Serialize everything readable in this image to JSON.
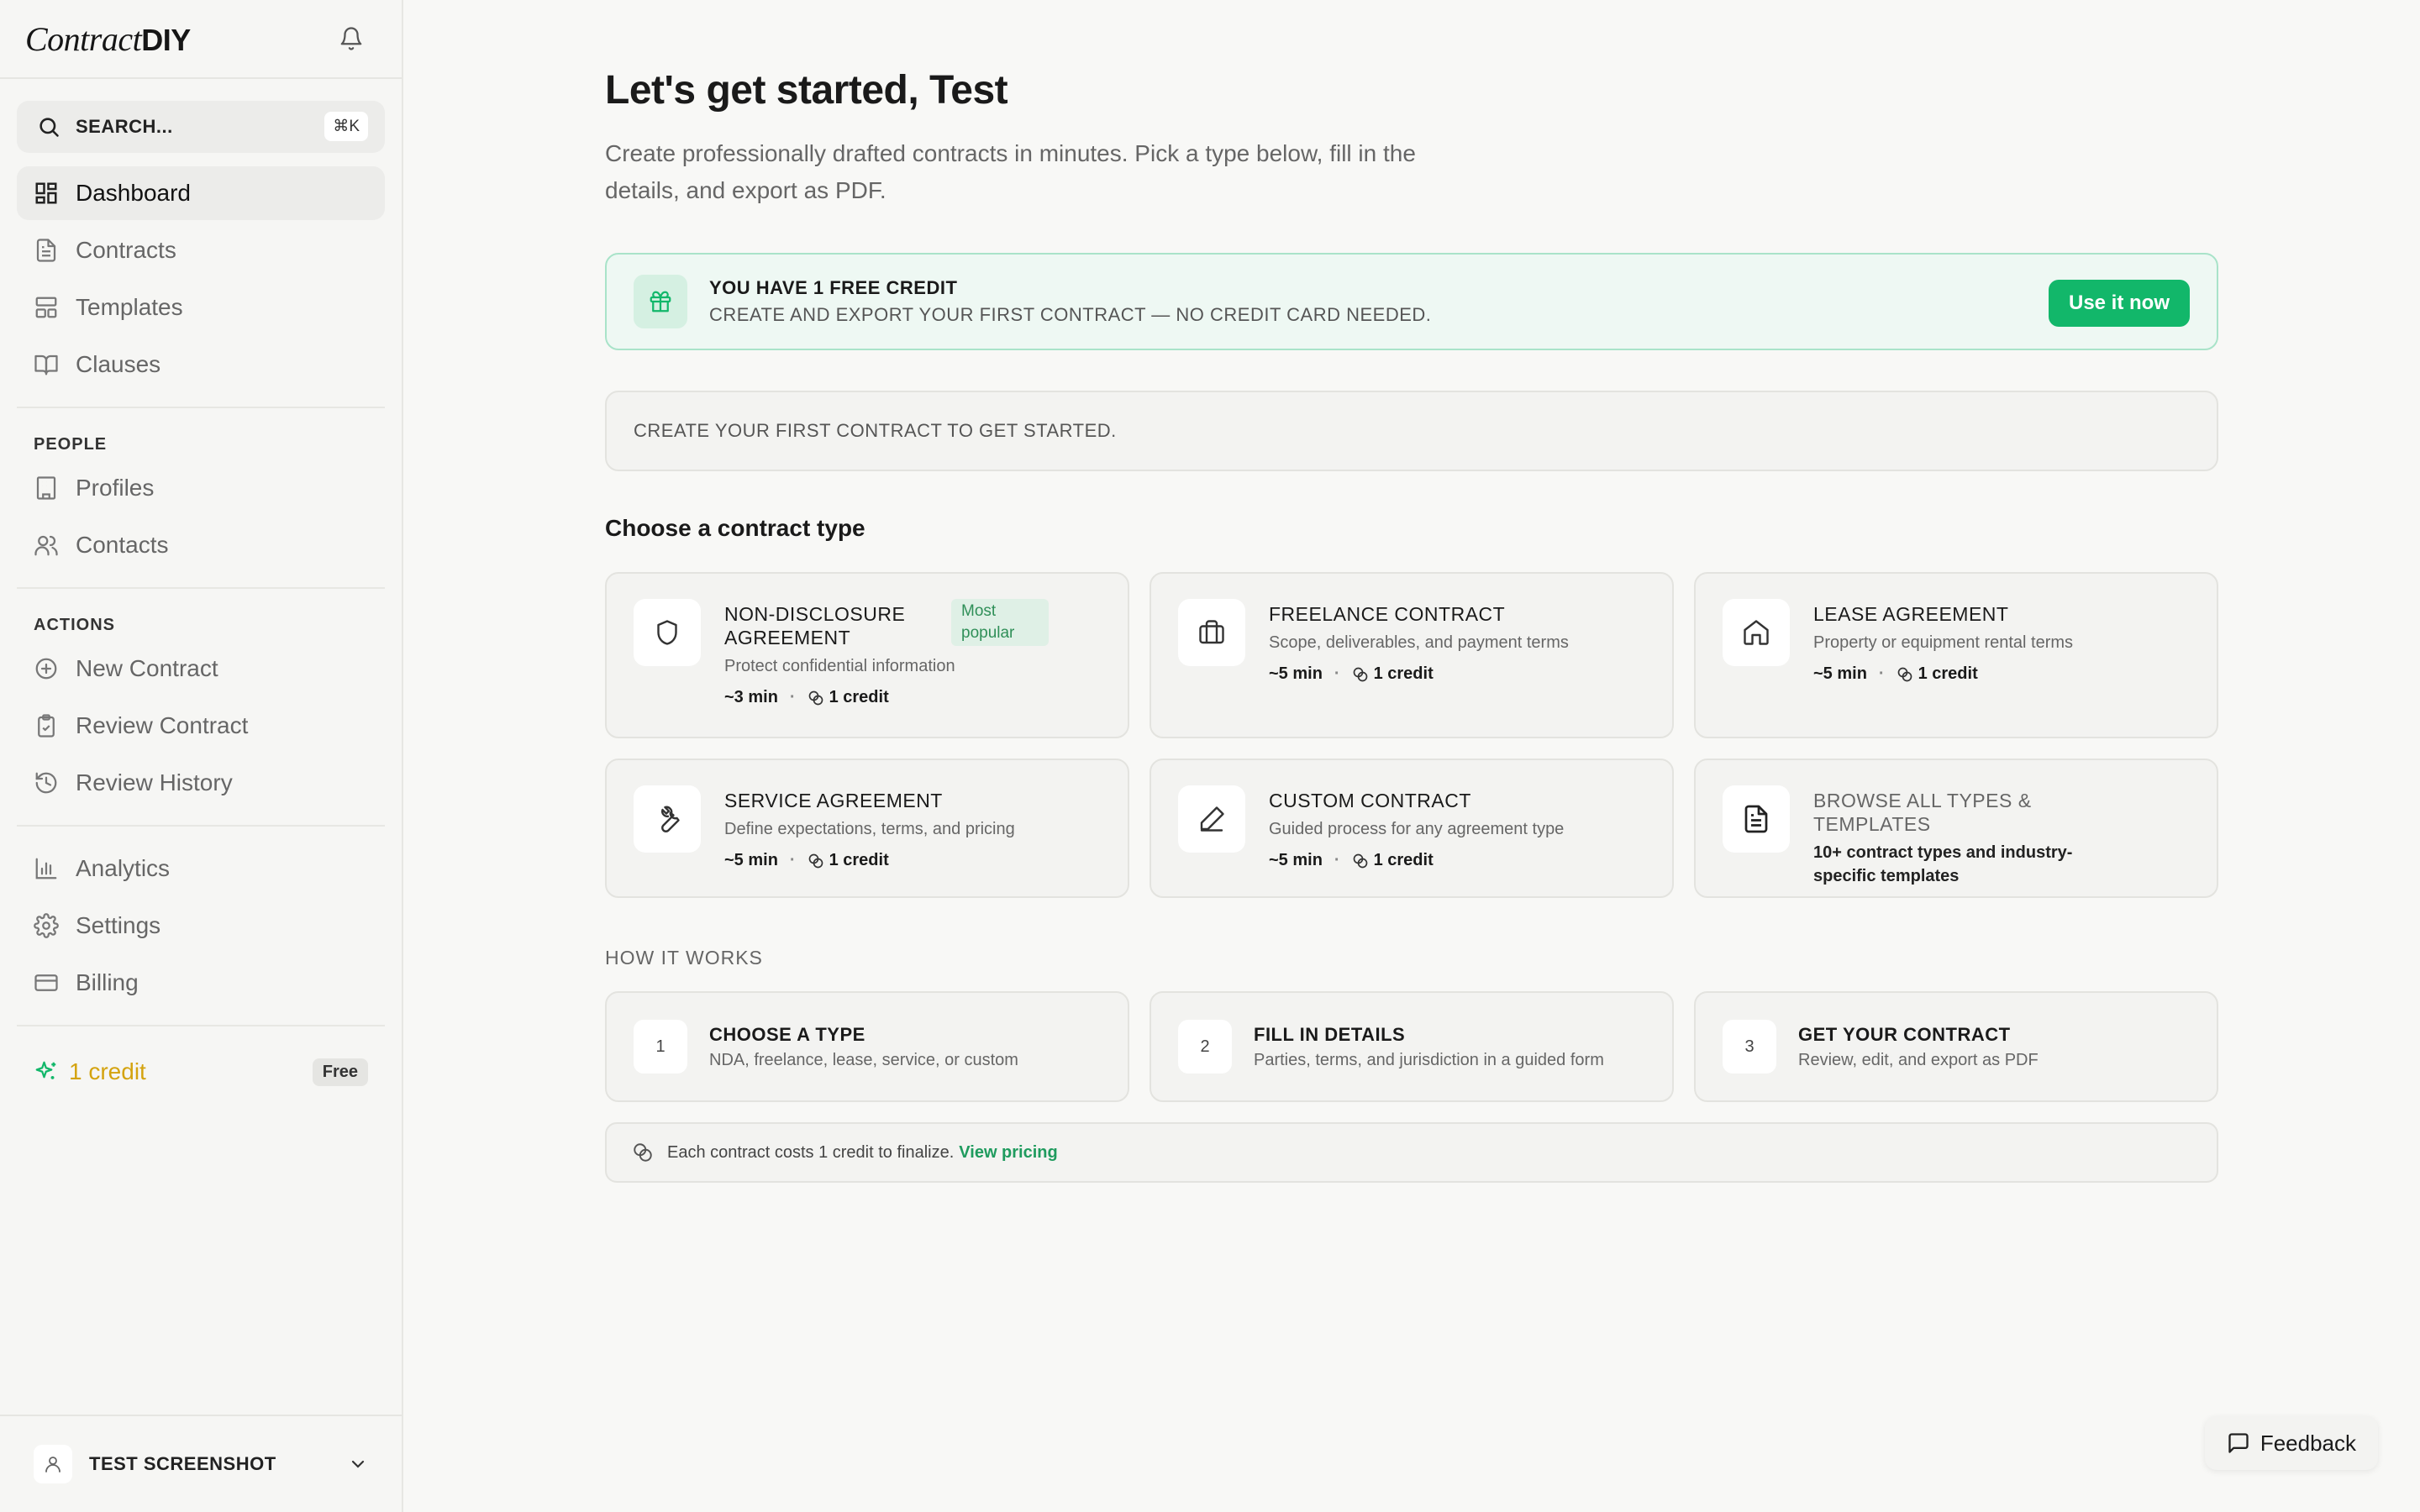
{
  "brand": {
    "italic": "Contract",
    "bold": "DIY"
  },
  "search": {
    "label": "SEARCH...",
    "shortcut": "⌘K"
  },
  "sidebar": {
    "main": [
      {
        "label": "Dashboard",
        "icon": "grid-icon",
        "active": true
      },
      {
        "label": "Contracts",
        "icon": "file-text-icon"
      },
      {
        "label": "Templates",
        "icon": "layout-icon"
      },
      {
        "label": "Clauses",
        "icon": "book-open-icon"
      }
    ],
    "people_label": "PEOPLE",
    "people": [
      {
        "label": "Profiles",
        "icon": "building-icon"
      },
      {
        "label": "Contacts",
        "icon": "users-icon"
      }
    ],
    "actions_label": "ACTIONS",
    "actions": [
      {
        "label": "New Contract",
        "icon": "plus-circle-icon"
      },
      {
        "label": "Review Contract",
        "icon": "clipboard-check-icon"
      },
      {
        "label": "Review History",
        "icon": "history-icon"
      }
    ],
    "other": [
      {
        "label": "Analytics",
        "icon": "bar-chart-icon"
      },
      {
        "label": "Settings",
        "icon": "gear-icon"
      },
      {
        "label": "Billing",
        "icon": "credit-card-icon"
      }
    ],
    "credits": "1 credit",
    "plan": "Free",
    "user": "TEST SCREENSHOT"
  },
  "main": {
    "title": "Let's get started, Test",
    "intro": "Create professionally drafted contracts in minutes. Pick a type below, fill in the details, and export as PDF.",
    "banner": {
      "title": "YOU HAVE 1 FREE CREDIT",
      "subtitle": "CREATE AND EXPORT YOUR FIRST CONTRACT — NO CREDIT CARD NEEDED.",
      "button": "Use it now"
    },
    "empty": "CREATE YOUR FIRST CONTRACT TO GET STARTED.",
    "choose_heading": "Choose a contract type",
    "cards": [
      {
        "title": "NON-DISCLOSURE AGREEMENT",
        "badge": "Most popular",
        "desc": "Protect confidential information",
        "time": "~3 min",
        "credit": "1 credit"
      },
      {
        "title": "FREELANCE CONTRACT",
        "desc": "Scope, deliverables, and payment terms",
        "time": "~5 min",
        "credit": "1 credit"
      },
      {
        "title": "LEASE AGREEMENT",
        "desc": "Property or equipment rental terms",
        "time": "~5 min",
        "credit": "1 credit"
      },
      {
        "title": "SERVICE AGREEMENT",
        "desc": "Define expectations, terms, and pricing",
        "time": "~5 min",
        "credit": "1 credit"
      },
      {
        "title": "CUSTOM CONTRACT",
        "desc": "Guided process for any agreement type",
        "time": "~5 min",
        "credit": "1 credit"
      },
      {
        "title": "BROWSE ALL TYPES & TEMPLATES",
        "desc": "10+ contract types and industry-specific templates"
      }
    ],
    "how_label": "HOW IT WORKS",
    "steps": [
      {
        "num": "1",
        "title": "CHOOSE A TYPE",
        "desc": "NDA, freelance, lease, service, or custom"
      },
      {
        "num": "2",
        "title": "FILL IN DETAILS",
        "desc": "Parties, terms, and jurisdiction in a guided form"
      },
      {
        "num": "3",
        "title": "GET YOUR CONTRACT",
        "desc": "Review, edit, and export as PDF"
      }
    ],
    "note": "Each contract costs 1 credit to finalize.",
    "note_link": "View pricing"
  },
  "feedback": "Feedback",
  "colors": {
    "accent": "#12b76a",
    "credit": "#d4a30f",
    "banner_bg": "#eef8f3"
  }
}
